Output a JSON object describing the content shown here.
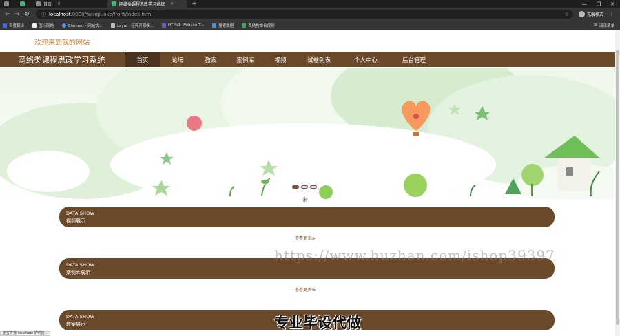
{
  "browser": {
    "tabs": [
      {
        "label": "",
        "active": false
      },
      {
        "label": "",
        "active": false
      },
      {
        "label": "首页",
        "active": false
      },
      {
        "label": "网络类课程思政学习系统",
        "active": true
      }
    ],
    "new_tab": "+",
    "address": {
      "host": "localhost",
      "path": ":8080/wangluoke/front/index.html"
    },
    "profile_label": "无痕模式",
    "bookmarks": [
      "百度翻译",
      "图标网站",
      "Element - 网站快...",
      "Layui - 经典开源模...",
      "HTML5 Website T...",
      "搜索数据",
      "表结构命名规则"
    ],
    "reading_list": "阅读清单",
    "window_controls": [
      "—",
      "❐",
      "✕"
    ]
  },
  "header": {
    "welcome": "欢迎来到我的网站"
  },
  "navbar": {
    "site_title": "网络类课程思政学习系统",
    "items": [
      {
        "label": "首页",
        "active": true
      },
      {
        "label": "论坛"
      },
      {
        "label": "教案"
      },
      {
        "label": "案例库"
      },
      {
        "label": "视频"
      },
      {
        "label": "试卷列表"
      },
      {
        "label": "个人中心"
      },
      {
        "label": "后台管理"
      }
    ]
  },
  "sections": [
    {
      "en": "DATA SHOW",
      "cn": "视频展示",
      "more": "查看更多≫"
    },
    {
      "en": "DATA SHOW",
      "cn": "案例库展示",
      "more": "查看更多≫"
    },
    {
      "en": "DATA SHOW",
      "cn": "教案展示"
    }
  ],
  "overlays": {
    "watermark": "https://www.huzhan.com/ishop39397",
    "promo": "专业毕设代做",
    "status": "正在等待 localhost 的响应..."
  },
  "colors": {
    "brand": "#6b4a2b",
    "welcome": "#d87a2c",
    "active_nav": "#4a3320"
  }
}
